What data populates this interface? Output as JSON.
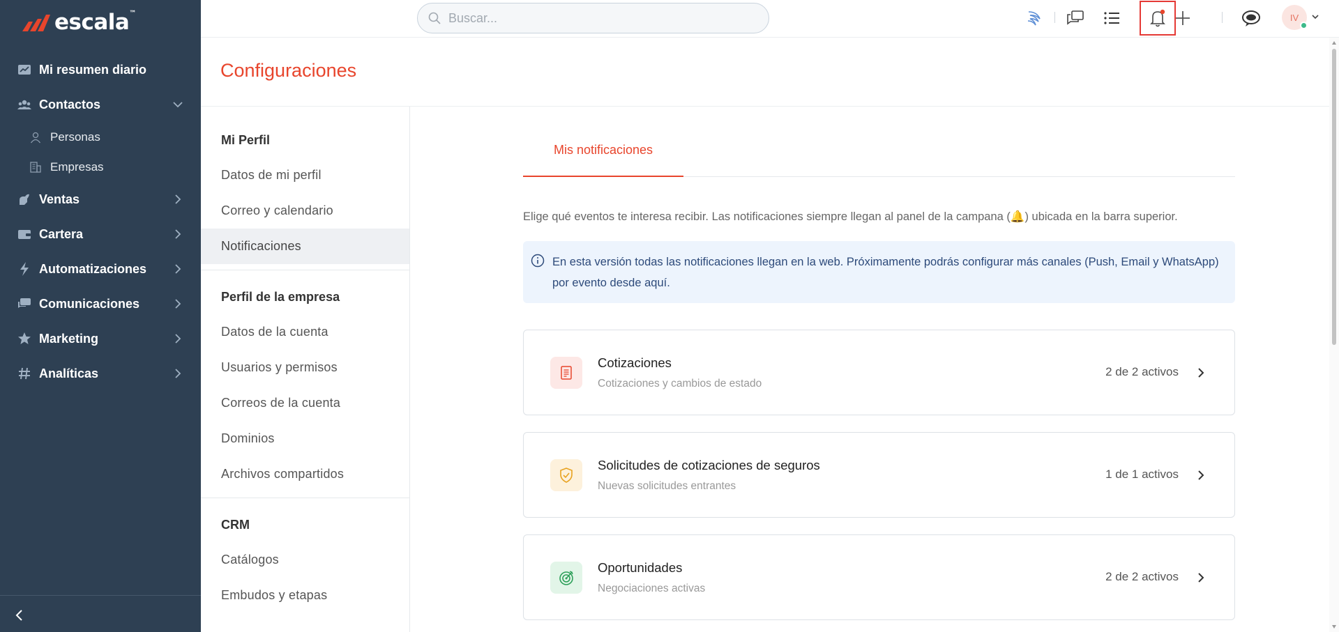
{
  "brand": {
    "name": "escala",
    "tm": "™"
  },
  "sidebar": {
    "items": [
      {
        "label": "Mi resumen diario",
        "icon": "chart-icon"
      },
      {
        "label": "Contactos",
        "icon": "contacts-icon",
        "expanded": true,
        "children": [
          {
            "label": "Personas",
            "icon": "person-icon"
          },
          {
            "label": "Empresas",
            "icon": "building-icon"
          }
        ]
      },
      {
        "label": "Ventas",
        "icon": "ventas-icon"
      },
      {
        "label": "Cartera",
        "icon": "wallet-icon"
      },
      {
        "label": "Automatizaciones",
        "icon": "bolt-icon"
      },
      {
        "label": "Comunicaciones",
        "icon": "chat-icon"
      },
      {
        "label": "Marketing",
        "icon": "star-icon"
      },
      {
        "label": "Analíticas",
        "icon": "hash-icon"
      }
    ]
  },
  "topbar": {
    "search_placeholder": "Buscar...",
    "avatar_initials": "IV",
    "notification_dot_color": "#e8452c"
  },
  "page": {
    "title": "Configuraciones"
  },
  "settings_menu": {
    "groups": [
      {
        "title": "Mi Perfil",
        "items": [
          "Datos de mi perfil",
          "Correo y calendario",
          "Notificaciones"
        ]
      },
      {
        "title": "Perfil de la empresa",
        "items": [
          "Datos de la cuenta",
          "Usuarios y permisos",
          "Correos de la cuenta",
          "Dominios",
          "Archivos compartidos"
        ]
      },
      {
        "title": "CRM",
        "items": [
          "Catálogos",
          "Embudos y etapas"
        ]
      }
    ],
    "active_item": "Notificaciones"
  },
  "main": {
    "tab_label": "Mis notificaciones",
    "intro": "Elige qué eventos te interesa recibir. Las notificaciones siempre llegan al panel de la campana (🔔) ubicada en la barra superior.",
    "info": "En esta versión todas las notificaciones llegan en la web. Próximamente podrás configurar más canales (Push, Email y WhatsApp) por evento desde aquí.",
    "cards": [
      {
        "title": "Cotizaciones",
        "desc": "Cotizaciones y cambios de estado",
        "count": "2 de 2 activos",
        "icon": "document-icon",
        "icon_bg": "#fde8e6",
        "icon_color": "#e8452c"
      },
      {
        "title": "Solicitudes de cotizaciones de seguros",
        "desc": "Nuevas solicitudes entrantes",
        "count": "1 de 1 activos",
        "icon": "shield-check-icon",
        "icon_bg": "#fdf1dc",
        "icon_color": "#e8a21f"
      },
      {
        "title": "Oportunidades",
        "desc": "Negociaciones activas",
        "count": "2 de 2 activos",
        "icon": "target-icon",
        "icon_bg": "#e2f5e8",
        "icon_color": "#2ea05a"
      }
    ]
  },
  "colors": {
    "accent": "#e8452c",
    "sidebar_bg": "#2e4053",
    "info_bg": "#edf4fd"
  }
}
